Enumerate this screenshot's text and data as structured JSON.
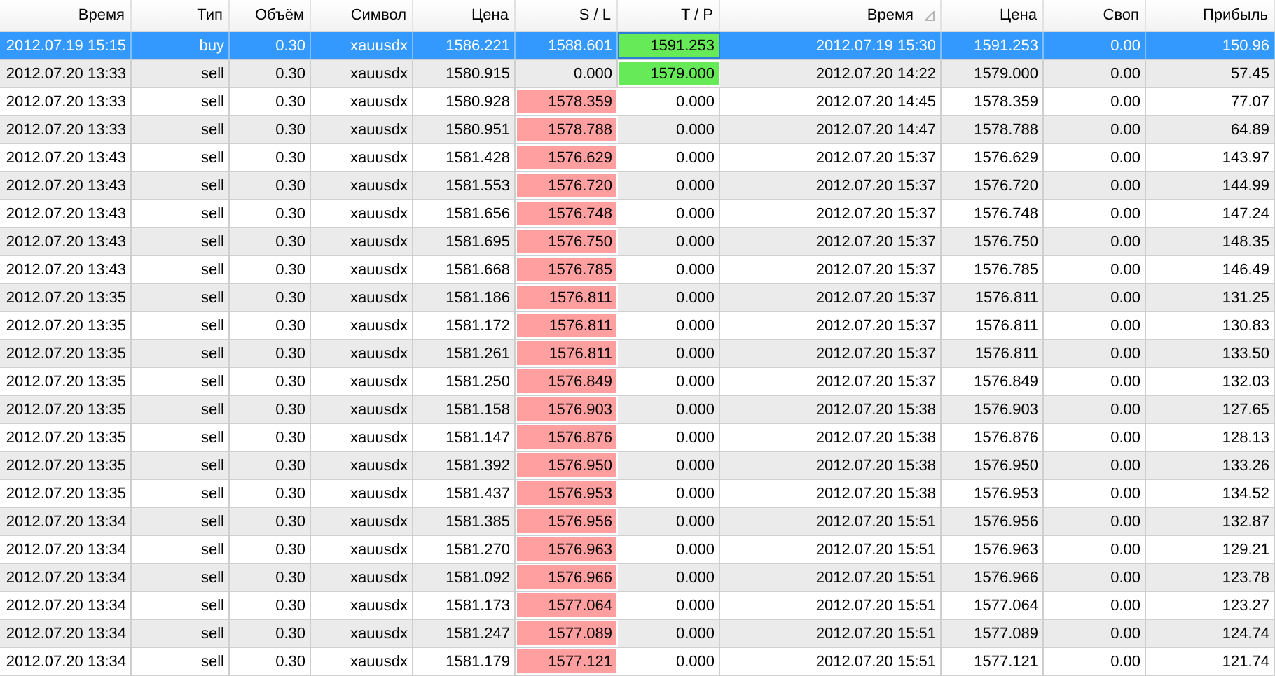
{
  "table": {
    "columns": [
      {
        "label": "Время",
        "sorted": false
      },
      {
        "label": "Тип",
        "sorted": false
      },
      {
        "label": "Объём",
        "sorted": false
      },
      {
        "label": "Символ",
        "sorted": false
      },
      {
        "label": "Цена",
        "sorted": false
      },
      {
        "label": "S / L",
        "sorted": false
      },
      {
        "label": "T / P",
        "sorted": false
      },
      {
        "label": "Время",
        "sorted": true
      },
      {
        "label": "Цена",
        "sorted": false
      },
      {
        "label": "Своп",
        "sorted": false
      },
      {
        "label": "Прибыль",
        "sorted": false
      }
    ],
    "rows": [
      {
        "selected": true,
        "sl_marked": false,
        "tp_marked": true,
        "cells": [
          "2012.07.19 15:15",
          "buy",
          "0.30",
          "xauusdx",
          "1586.221",
          "1588.601",
          "1591.253",
          "2012.07.19 15:30",
          "1591.253",
          "0.00",
          "150.96"
        ]
      },
      {
        "selected": false,
        "sl_marked": false,
        "tp_marked": true,
        "cells": [
          "2012.07.20 13:33",
          "sell",
          "0.30",
          "xauusdx",
          "1580.915",
          "0.000",
          "1579.000",
          "2012.07.20 14:22",
          "1579.000",
          "0.00",
          "57.45"
        ]
      },
      {
        "selected": false,
        "sl_marked": true,
        "tp_marked": false,
        "cells": [
          "2012.07.20 13:33",
          "sell",
          "0.30",
          "xauusdx",
          "1580.928",
          "1578.359",
          "0.000",
          "2012.07.20 14:45",
          "1578.359",
          "0.00",
          "77.07"
        ]
      },
      {
        "selected": false,
        "sl_marked": true,
        "tp_marked": false,
        "cells": [
          "2012.07.20 13:33",
          "sell",
          "0.30",
          "xauusdx",
          "1580.951",
          "1578.788",
          "0.000",
          "2012.07.20 14:47",
          "1578.788",
          "0.00",
          "64.89"
        ]
      },
      {
        "selected": false,
        "sl_marked": true,
        "tp_marked": false,
        "cells": [
          "2012.07.20 13:43",
          "sell",
          "0.30",
          "xauusdx",
          "1581.428",
          "1576.629",
          "0.000",
          "2012.07.20 15:37",
          "1576.629",
          "0.00",
          "143.97"
        ]
      },
      {
        "selected": false,
        "sl_marked": true,
        "tp_marked": false,
        "cells": [
          "2012.07.20 13:43",
          "sell",
          "0.30",
          "xauusdx",
          "1581.553",
          "1576.720",
          "0.000",
          "2012.07.20 15:37",
          "1576.720",
          "0.00",
          "144.99"
        ]
      },
      {
        "selected": false,
        "sl_marked": true,
        "tp_marked": false,
        "cells": [
          "2012.07.20 13:43",
          "sell",
          "0.30",
          "xauusdx",
          "1581.656",
          "1576.748",
          "0.000",
          "2012.07.20 15:37",
          "1576.748",
          "0.00",
          "147.24"
        ]
      },
      {
        "selected": false,
        "sl_marked": true,
        "tp_marked": false,
        "cells": [
          "2012.07.20 13:43",
          "sell",
          "0.30",
          "xauusdx",
          "1581.695",
          "1576.750",
          "0.000",
          "2012.07.20 15:37",
          "1576.750",
          "0.00",
          "148.35"
        ]
      },
      {
        "selected": false,
        "sl_marked": true,
        "tp_marked": false,
        "cells": [
          "2012.07.20 13:43",
          "sell",
          "0.30",
          "xauusdx",
          "1581.668",
          "1576.785",
          "0.000",
          "2012.07.20 15:37",
          "1576.785",
          "0.00",
          "146.49"
        ]
      },
      {
        "selected": false,
        "sl_marked": true,
        "tp_marked": false,
        "cells": [
          "2012.07.20 13:35",
          "sell",
          "0.30",
          "xauusdx",
          "1581.186",
          "1576.811",
          "0.000",
          "2012.07.20 15:37",
          "1576.811",
          "0.00",
          "131.25"
        ]
      },
      {
        "selected": false,
        "sl_marked": true,
        "tp_marked": false,
        "cells": [
          "2012.07.20 13:35",
          "sell",
          "0.30",
          "xauusdx",
          "1581.172",
          "1576.811",
          "0.000",
          "2012.07.20 15:37",
          "1576.811",
          "0.00",
          "130.83"
        ]
      },
      {
        "selected": false,
        "sl_marked": true,
        "tp_marked": false,
        "cells": [
          "2012.07.20 13:35",
          "sell",
          "0.30",
          "xauusdx",
          "1581.261",
          "1576.811",
          "0.000",
          "2012.07.20 15:37",
          "1576.811",
          "0.00",
          "133.50"
        ]
      },
      {
        "selected": false,
        "sl_marked": true,
        "tp_marked": false,
        "cells": [
          "2012.07.20 13:35",
          "sell",
          "0.30",
          "xauusdx",
          "1581.250",
          "1576.849",
          "0.000",
          "2012.07.20 15:37",
          "1576.849",
          "0.00",
          "132.03"
        ]
      },
      {
        "selected": false,
        "sl_marked": true,
        "tp_marked": false,
        "cells": [
          "2012.07.20 13:35",
          "sell",
          "0.30",
          "xauusdx",
          "1581.158",
          "1576.903",
          "0.000",
          "2012.07.20 15:38",
          "1576.903",
          "0.00",
          "127.65"
        ]
      },
      {
        "selected": false,
        "sl_marked": true,
        "tp_marked": false,
        "cells": [
          "2012.07.20 13:35",
          "sell",
          "0.30",
          "xauusdx",
          "1581.147",
          "1576.876",
          "0.000",
          "2012.07.20 15:38",
          "1576.876",
          "0.00",
          "128.13"
        ]
      },
      {
        "selected": false,
        "sl_marked": true,
        "tp_marked": false,
        "cells": [
          "2012.07.20 13:35",
          "sell",
          "0.30",
          "xauusdx",
          "1581.392",
          "1576.950",
          "0.000",
          "2012.07.20 15:38",
          "1576.950",
          "0.00",
          "133.26"
        ]
      },
      {
        "selected": false,
        "sl_marked": true,
        "tp_marked": false,
        "cells": [
          "2012.07.20 13:35",
          "sell",
          "0.30",
          "xauusdx",
          "1581.437",
          "1576.953",
          "0.000",
          "2012.07.20 15:38",
          "1576.953",
          "0.00",
          "134.52"
        ]
      },
      {
        "selected": false,
        "sl_marked": true,
        "tp_marked": false,
        "cells": [
          "2012.07.20 13:34",
          "sell",
          "0.30",
          "xauusdx",
          "1581.385",
          "1576.956",
          "0.000",
          "2012.07.20 15:51",
          "1576.956",
          "0.00",
          "132.87"
        ]
      },
      {
        "selected": false,
        "sl_marked": true,
        "tp_marked": false,
        "cells": [
          "2012.07.20 13:34",
          "sell",
          "0.30",
          "xauusdx",
          "1581.270",
          "1576.963",
          "0.000",
          "2012.07.20 15:51",
          "1576.963",
          "0.00",
          "129.21"
        ]
      },
      {
        "selected": false,
        "sl_marked": true,
        "tp_marked": false,
        "cells": [
          "2012.07.20 13:34",
          "sell",
          "0.30",
          "xauusdx",
          "1581.092",
          "1576.966",
          "0.000",
          "2012.07.20 15:51",
          "1576.966",
          "0.00",
          "123.78"
        ]
      },
      {
        "selected": false,
        "sl_marked": true,
        "tp_marked": false,
        "cells": [
          "2012.07.20 13:34",
          "sell",
          "0.30",
          "xauusdx",
          "1581.173",
          "1577.064",
          "0.000",
          "2012.07.20 15:51",
          "1577.064",
          "0.00",
          "123.27"
        ]
      },
      {
        "selected": false,
        "sl_marked": true,
        "tp_marked": false,
        "cells": [
          "2012.07.20 13:34",
          "sell",
          "0.30",
          "xauusdx",
          "1581.247",
          "1577.089",
          "0.000",
          "2012.07.20 15:51",
          "1577.089",
          "0.00",
          "124.74"
        ]
      },
      {
        "selected": false,
        "sl_marked": true,
        "tp_marked": false,
        "cells": [
          "2012.07.20 13:34",
          "sell",
          "0.30",
          "xauusdx",
          "1581.179",
          "1577.121",
          "0.000",
          "2012.07.20 15:51",
          "1577.121",
          "0.00",
          "121.74"
        ]
      }
    ]
  }
}
